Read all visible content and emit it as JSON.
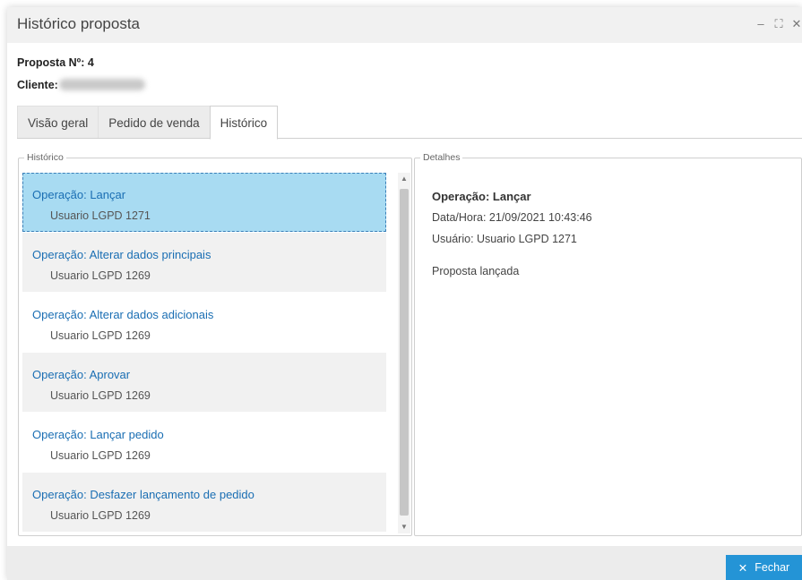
{
  "window": {
    "title": "Histórico proposta",
    "controls": {
      "minimize": "–",
      "maximize": "⛶",
      "close": "✕"
    }
  },
  "info": {
    "proposta_label": "Proposta Nº:",
    "proposta_value": "4",
    "cliente_label": "Cliente:"
  },
  "tabs": [
    {
      "label": "Visão geral"
    },
    {
      "label": "Pedido de venda"
    },
    {
      "label": "Histórico",
      "active": true
    }
  ],
  "historico": {
    "legend": "Histórico",
    "items": [
      {
        "operation": "Operação: Lançar",
        "user": "Usuario LGPD 1271",
        "selected": true
      },
      {
        "operation": "Operação: Alterar dados principais",
        "user": "Usuario LGPD 1269"
      },
      {
        "operation": "Operação: Alterar dados adicionais",
        "user": "Usuario LGPD 1269"
      },
      {
        "operation": "Operação: Aprovar",
        "user": "Usuario LGPD 1269"
      },
      {
        "operation": "Operação: Lançar pedido",
        "user": "Usuario LGPD 1269"
      },
      {
        "operation": "Operação: Desfazer lançamento de pedido",
        "user": "Usuario LGPD 1269"
      }
    ]
  },
  "detalhes": {
    "legend": "Detalhes",
    "operation": "Operação: Lançar",
    "datetime": "Data/Hora: 21/09/2021 10:43:46",
    "user": "Usuário: Usuario LGPD 1271",
    "description": "Proposta lançada"
  },
  "footer": {
    "close_label": "Fechar",
    "close_icon": "close-icon"
  },
  "colors": {
    "accent": "#2494d6",
    "selected_row": "#a8dbf2",
    "link_text": "#1a6eb3"
  }
}
